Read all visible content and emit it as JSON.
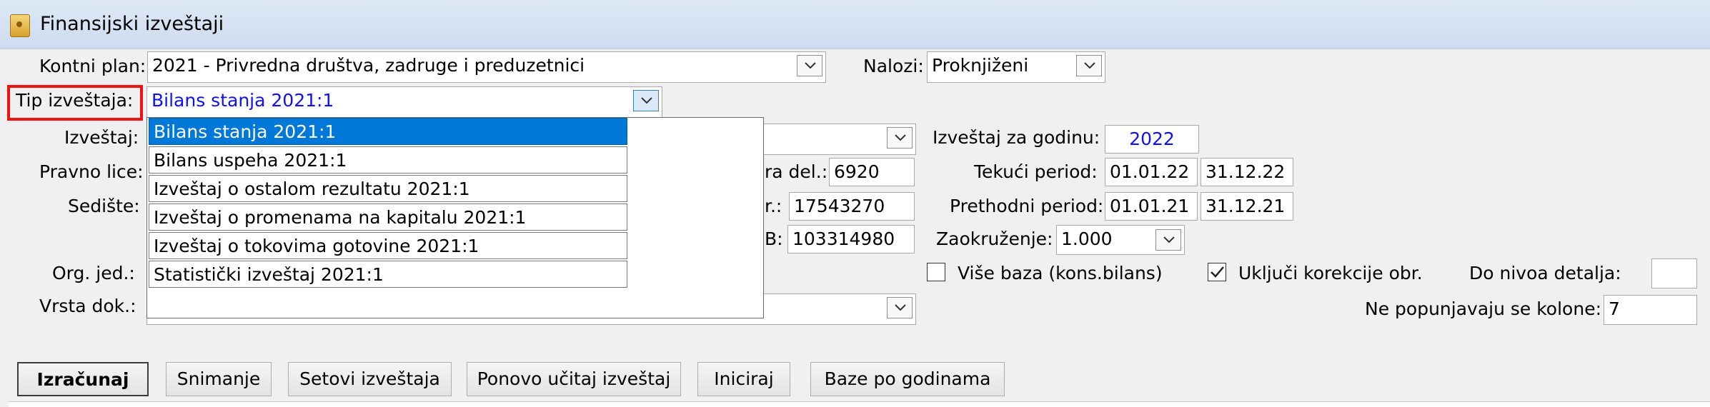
{
  "window": {
    "title": "Finansijski izveštaji",
    "icon": "report-folder-icon"
  },
  "form": {
    "kontni_plan_label": "Kontni plan:",
    "kontni_plan_value": "2021 - Privredna društva, zadruge i preduzetnici",
    "nalozi_label": "Nalozi:",
    "nalozi_value": "Proknjiženi",
    "tip_label": "Tip izveštaja:",
    "tip_value": "Bilans stanja 2021:1",
    "izvestaj_label": "Izveštaj:",
    "pravno_lice_label": "Pravno lice:",
    "sediste_label": "Sedište:",
    "org_label": "Org. jed.:",
    "vrsta_label": "Vrsta dok.:",
    "sifra_del_label": "ra del.:",
    "sifra_del_value": "6920",
    "mb_label": "r.:",
    "mb_value": "17543270",
    "pib_label": "B:",
    "pib_value": "103314980",
    "godina_label": "Izveštaj za godinu:",
    "godina_value": "2022",
    "tekuci_label": "Tekući period:",
    "tekuci_from": "01.01.22",
    "tekuci_to": "31.12.22",
    "prethodni_label": "Prethodni period:",
    "prethodni_from": "01.01.21",
    "prethodni_to": "31.12.21",
    "zaokruzenje_label": "Zaokruženje:",
    "zaokruzenje_value": "1.000",
    "vise_baza_label": "Više baza (kons.bilans)",
    "vise_baza_checked": false,
    "ukljuci_label": "Uključi korekcije obr.",
    "ukljuci_checked": true,
    "do_nivoa_label": "Do nivoa detalja:",
    "do_nivoa_value": "",
    "ne_popunjavaju_label": "Ne popunjavaju se kolone:",
    "ne_popunjavaju_value": "7"
  },
  "dropdown": {
    "items": [
      "Bilans stanja 2021:1",
      "Bilans uspeha 2021:1",
      "Izveštaj o ostalom rezultatu 2021:1",
      "Izveštaj o promenama na kapitalu 2021:1",
      "Izveštaj o tokovima gotovine 2021:1",
      "Statistički izveštaj 2021:1"
    ],
    "selected_index": 0
  },
  "buttons": {
    "izracunaj": "Izračunaj",
    "snimanje": "Snimanje",
    "setovi": "Setovi izveštaja",
    "ponovo": "Ponovo učitaj izveštaj",
    "iniciraj": "Iniciraj",
    "baze": "Baze po godinama"
  },
  "colors": {
    "accent": "#0078d7",
    "highlight_border": "#e11111",
    "value_blue": "#1010ff"
  }
}
